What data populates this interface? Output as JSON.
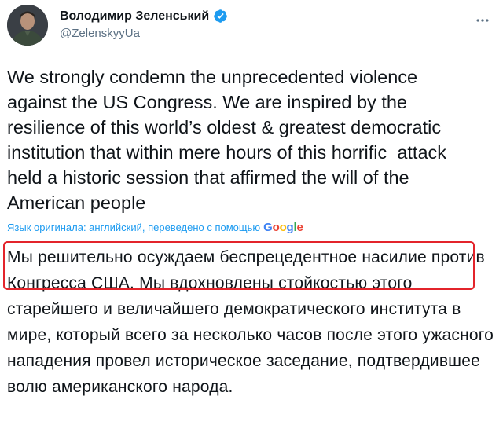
{
  "author": {
    "display_name": "Володимир Зеленський",
    "handle": "@ZelenskyyUa",
    "verified": true,
    "avatar_icon": "profile-photo"
  },
  "menu": {
    "icon": "more-horizontal-icon"
  },
  "tweet": {
    "text": "We strongly condemn the unprecedented violence\nagainst the US Congress. We are inspired by the\nresilience of this world’s oldest & greatest democratic\ninstitution that within mere hours of this horrific  attack\nheld a historic session that affirmed the will of the\nAmerican people"
  },
  "translation": {
    "note": "Язык оригинала: английский, переведено с помощью",
    "provider": "Google",
    "text": "Мы решительно осуждаем беспрецедентное насилие против Конгресса США. Мы вдохновлены стойкостью этого старейшего и величайшего демократического института в мире, который всего за несколько часов после этого ужасного нападения провел историческое заседание, подтвердившее волю американского народа."
  },
  "colors": {
    "link_blue": "#1d9bf0",
    "verified_blue": "#1d9bf0",
    "secondary_text": "#5b7083",
    "highlight_red": "#e3242b"
  }
}
